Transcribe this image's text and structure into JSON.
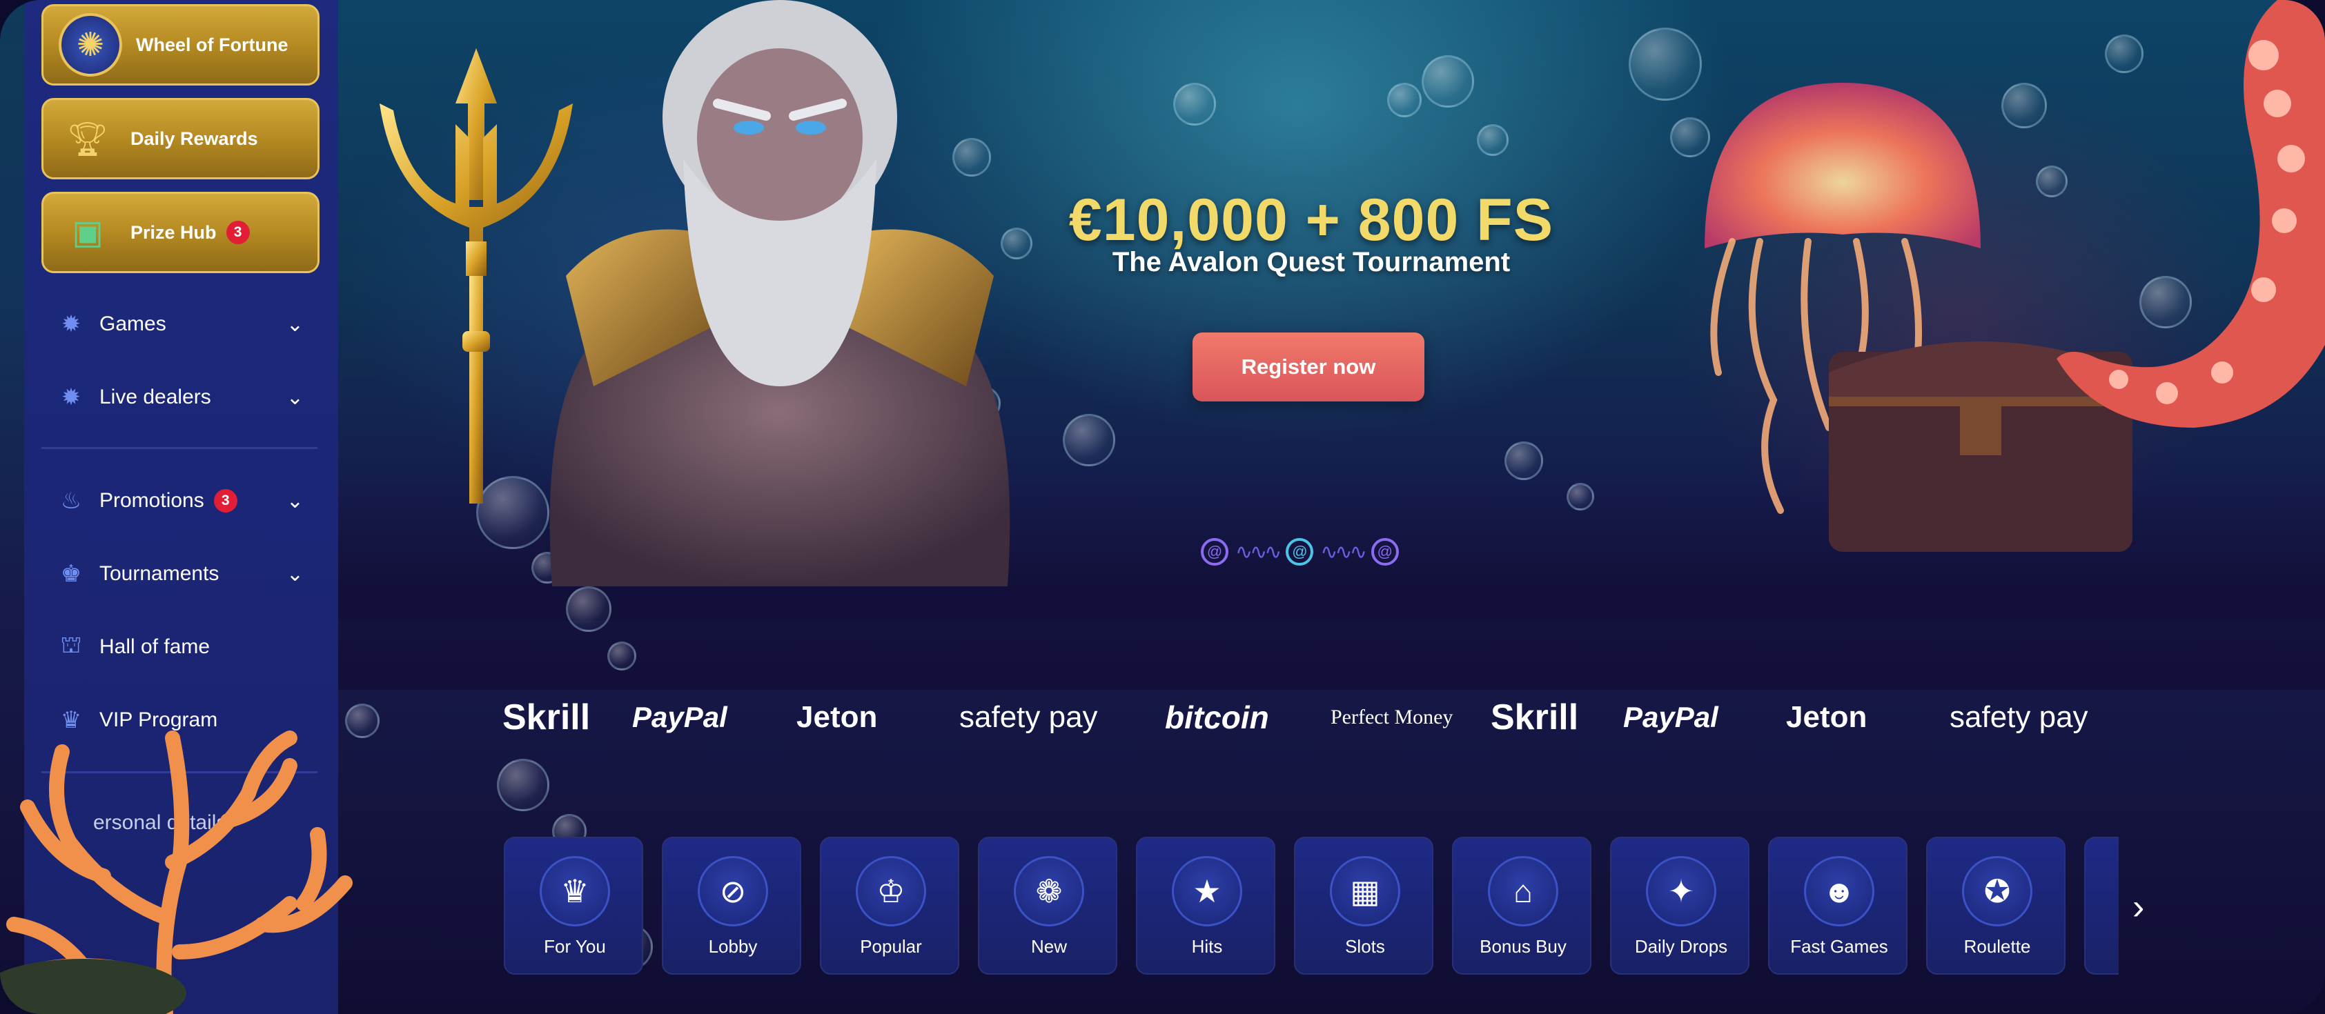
{
  "sidebar": {
    "promos": [
      {
        "label": "Wheel of Fortune",
        "icon": "wheel-icon"
      },
      {
        "label": "Daily Rewards",
        "icon": "trophy-icon"
      },
      {
        "label": "Prize Hub",
        "icon": "treasure-chest-icon",
        "badge": "3"
      }
    ],
    "nav": [
      {
        "label": "Games",
        "icon": "games-icon",
        "chevron": "⌄"
      },
      {
        "label": "Live dealers",
        "icon": "live-dealers-icon",
        "chevron": "⌄"
      },
      {
        "label": "Promotions",
        "icon": "promotions-icon",
        "badge": "3",
        "chevron": "⌄"
      },
      {
        "label": "Tournaments",
        "icon": "tournaments-icon",
        "chevron": "⌄"
      },
      {
        "label": "Hall of fame",
        "icon": "hall-of-fame-icon"
      },
      {
        "label": "VIP Program",
        "icon": "crown-icon"
      }
    ],
    "partial_item": "ersonal details"
  },
  "hero": {
    "title": "€10,000 + 800 FS",
    "subtitle": "The Avalon Quest Tournament",
    "register_label": "Register now"
  },
  "payments": [
    "Skrill",
    "PayPal",
    "Jeton",
    "safety pay",
    "bitcoin",
    "Perfect Money",
    "Skrill",
    "PayPal",
    "Jeton",
    "safety pay"
  ],
  "categories": [
    {
      "label": "For You",
      "icon": "for-you-icon"
    },
    {
      "label": "Lobby",
      "icon": "lobby-icon"
    },
    {
      "label": "Popular",
      "icon": "crown-icon"
    },
    {
      "label": "New",
      "icon": "shell-icon"
    },
    {
      "label": "Hits",
      "icon": "star-icon"
    },
    {
      "label": "Slots",
      "icon": "slots-icon"
    },
    {
      "label": "Bonus Buy",
      "icon": "bonus-buy-icon"
    },
    {
      "label": "Daily Drops",
      "icon": "daily-drops-icon"
    },
    {
      "label": "Fast Games",
      "icon": "fast-games-icon"
    },
    {
      "label": "Roulette",
      "icon": "roulette-icon"
    }
  ],
  "colors": {
    "sidebar": "#1d2a7d",
    "gold": "#d2a93a",
    "accent": "#e21d36",
    "hero_title": "#f1d96a",
    "register": "#e0605e"
  }
}
